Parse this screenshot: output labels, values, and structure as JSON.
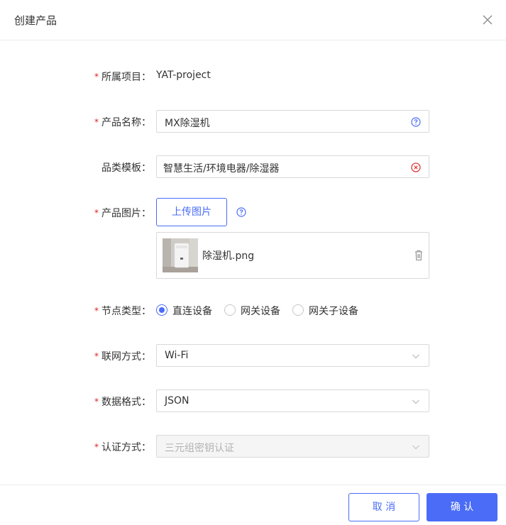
{
  "dialog": {
    "title": "创建产品"
  },
  "form": {
    "required_mark": "*",
    "project": {
      "label": "所属项目：",
      "value": "YAT-project"
    },
    "product_name": {
      "label": "产品名称：",
      "value": "MX除湿机"
    },
    "category": {
      "label": "品类模板：",
      "value": "智慧生活/环境电器/除湿器"
    },
    "image": {
      "label": "产品图片：",
      "upload_label": "上传图片",
      "file_name": "除湿机.png"
    },
    "node_type": {
      "label": "节点类型：",
      "options": [
        "直连设备",
        "网关设备",
        "网关子设备"
      ],
      "selected": "直连设备"
    },
    "network": {
      "label": "联网方式：",
      "value": "Wi-Fi"
    },
    "data_format": {
      "label": "数据格式：",
      "value": "JSON"
    },
    "auth": {
      "label": "认证方式：",
      "value": "三元组密钥认证"
    }
  },
  "footer": {
    "cancel_label": "取 消",
    "confirm_label": "确 认"
  },
  "colors": {
    "primary": "#4a6cf7",
    "required": "#e02020",
    "clear_icon": "#e23c3c"
  }
}
